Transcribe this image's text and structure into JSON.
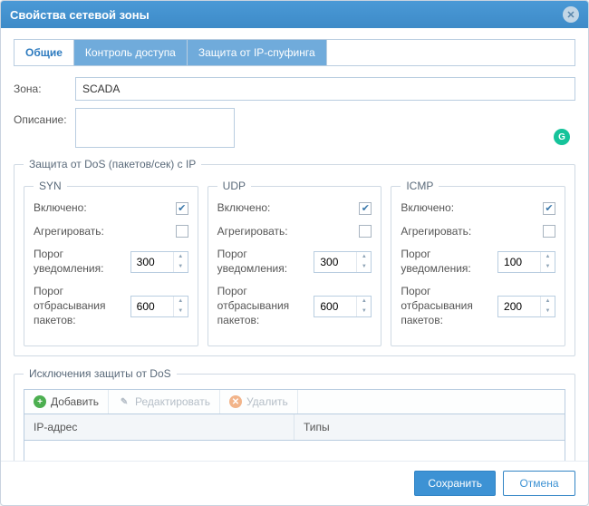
{
  "window": {
    "title": "Свойства сетевой зоны"
  },
  "tabs": {
    "general": "Общие",
    "access": "Контроль доступа",
    "spoof": "Защита от IP-спуфинга"
  },
  "fields": {
    "zone_label": "Зона:",
    "zone_value": "SCADA",
    "desc_label": "Описание:",
    "desc_value": ""
  },
  "dos": {
    "legend": "Защита от DoS (пакетов/сек) с IP",
    "labels": {
      "enabled": "Включено:",
      "aggregate": "Агрегировать:",
      "notify": "Порог уведомления:",
      "drop": "Порог отбрасывания пакетов:"
    },
    "syn": {
      "title": "SYN",
      "enabled": true,
      "aggregate": false,
      "notify": "300",
      "drop": "600"
    },
    "udp": {
      "title": "UDP",
      "enabled": true,
      "aggregate": false,
      "notify": "300",
      "drop": "600"
    },
    "icmp": {
      "title": "ICMP",
      "enabled": true,
      "aggregate": false,
      "notify": "100",
      "drop": "200"
    }
  },
  "exceptions": {
    "legend": "Исключения защиты от DoS",
    "toolbar": {
      "add": "Добавить",
      "edit": "Редактировать",
      "delete": "Удалить"
    },
    "columns": {
      "ip": "IP-адрес",
      "types": "Типы"
    }
  },
  "footer": {
    "save": "Сохранить",
    "cancel": "Отмена"
  }
}
